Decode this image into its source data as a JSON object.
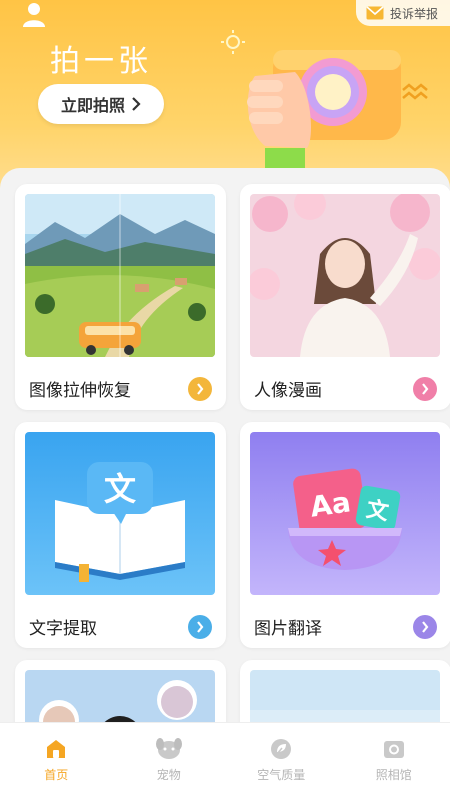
{
  "header": {
    "report_label": "投诉举报",
    "hero_title": "拍一张",
    "shoot_button": "立即拍照"
  },
  "cards": [
    {
      "label": "图像拉伸恢复",
      "arrow_color": "#f3b63b",
      "icon": "landscape-image"
    },
    {
      "label": "人像漫画",
      "arrow_color": "#f07fa8",
      "icon": "portrait-image"
    },
    {
      "label": "文字提取",
      "arrow_color": "#4aaee8",
      "icon": "text-book-icon"
    },
    {
      "label": "图片翻译",
      "arrow_color": "#9b86e8",
      "icon": "translate-icon"
    }
  ],
  "tabs": [
    {
      "label": "首页",
      "icon": "home-icon",
      "active": true
    },
    {
      "label": "宠物",
      "icon": "pet-icon",
      "active": false
    },
    {
      "label": "空气质量",
      "icon": "leaf-icon",
      "active": false
    },
    {
      "label": "照相馆",
      "icon": "camera-icon",
      "active": false
    }
  ],
  "colors": {
    "accent": "#f5a623",
    "hero": "#ffc445"
  },
  "card_text": {
    "wen": "文",
    "aa": "Aa"
  }
}
